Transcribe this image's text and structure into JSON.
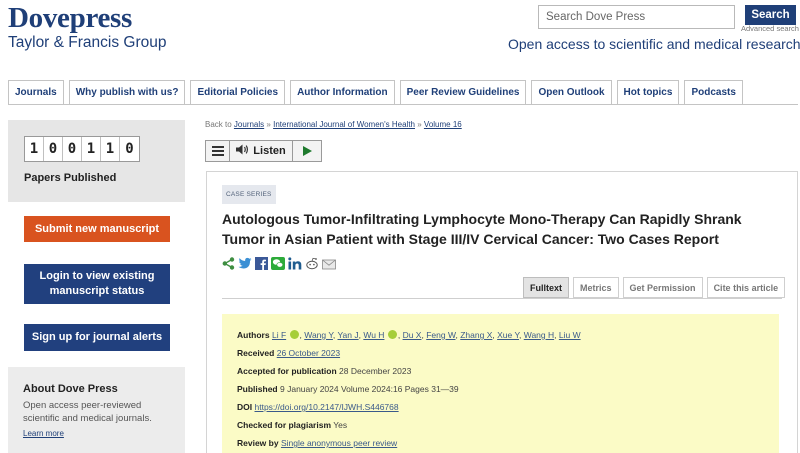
{
  "header": {
    "logo_main": "Dovepress",
    "logo_sub": "Taylor & Francis Group",
    "search_placeholder": "Search Dove Press",
    "search_button": "Search",
    "advanced_search": "Advanced search",
    "tagline": "Open access to scientific and medical research"
  },
  "nav": [
    "Journals",
    "Why publish with us?",
    "Editorial Policies",
    "Author Information",
    "Peer Review Guidelines",
    "Open Outlook",
    "Hot topics",
    "Podcasts"
  ],
  "sidebar": {
    "counter_digits": [
      "1",
      "0",
      "0",
      "1",
      "1",
      "0"
    ],
    "counter_label": "Papers Published",
    "submit_button": "Submit new manuscript",
    "login_button": "Login to view existing manuscript status",
    "alerts_button": "Sign up for journal alerts",
    "about_title": "About Dove Press",
    "about_text": "Open access peer-reviewed scientific and medical journals.",
    "about_link": "Learn more"
  },
  "breadcrumb": {
    "prefix": "Back to",
    "items": [
      "Journals",
      "International Journal of Women's Health",
      "Volume 16"
    ],
    "separator": "»"
  },
  "listen": {
    "label": "Listen",
    "icons": [
      "menu-icon",
      "speaker-icon",
      "play-icon"
    ]
  },
  "article": {
    "badge": "CASE SERIES",
    "title": "Autologous Tumor-Infiltrating Lymphocyte Mono-Therapy Can Rapidly Shrank Tumor in Asian Patient with Stage III/IV Cervical Cancer: Two Cases Report",
    "share_icons": [
      "share-icon",
      "twitter-icon",
      "facebook-icon",
      "wechat-icon",
      "linkedin-icon",
      "reddit-icon",
      "email-icon"
    ],
    "tabs": [
      "Fulltext",
      "Metrics",
      "Get Permission",
      "Cite this article"
    ],
    "active_tab": "Fulltext",
    "authors_label": "Authors",
    "authors": [
      "Li F",
      "Wang Y",
      "Yan J",
      "Wu H",
      "Du X",
      "Feng W",
      "Zhang X",
      "Xue Y",
      "Wang H",
      "Liu W"
    ],
    "received_label": "Received",
    "received": "26 October 2023",
    "accepted_label": "Accepted for publication",
    "accepted": "28 December 2023",
    "published_label": "Published",
    "published": "9 January 2024 Volume 2024:16 Pages 31—39",
    "doi_label": "DOI",
    "doi": "https://doi.org/10.2147/IJWH.S446768",
    "plagiarism_label": "Checked for plagiarism",
    "plagiarism": "Yes",
    "review_label": "Review by",
    "review": "Single anonymous peer review"
  },
  "colors": {
    "brand_blue": "#1f3f78",
    "submit_orange": "#d9531f",
    "info_yellow": "#fbfbc6",
    "orcid_green": "#a6ce39"
  }
}
